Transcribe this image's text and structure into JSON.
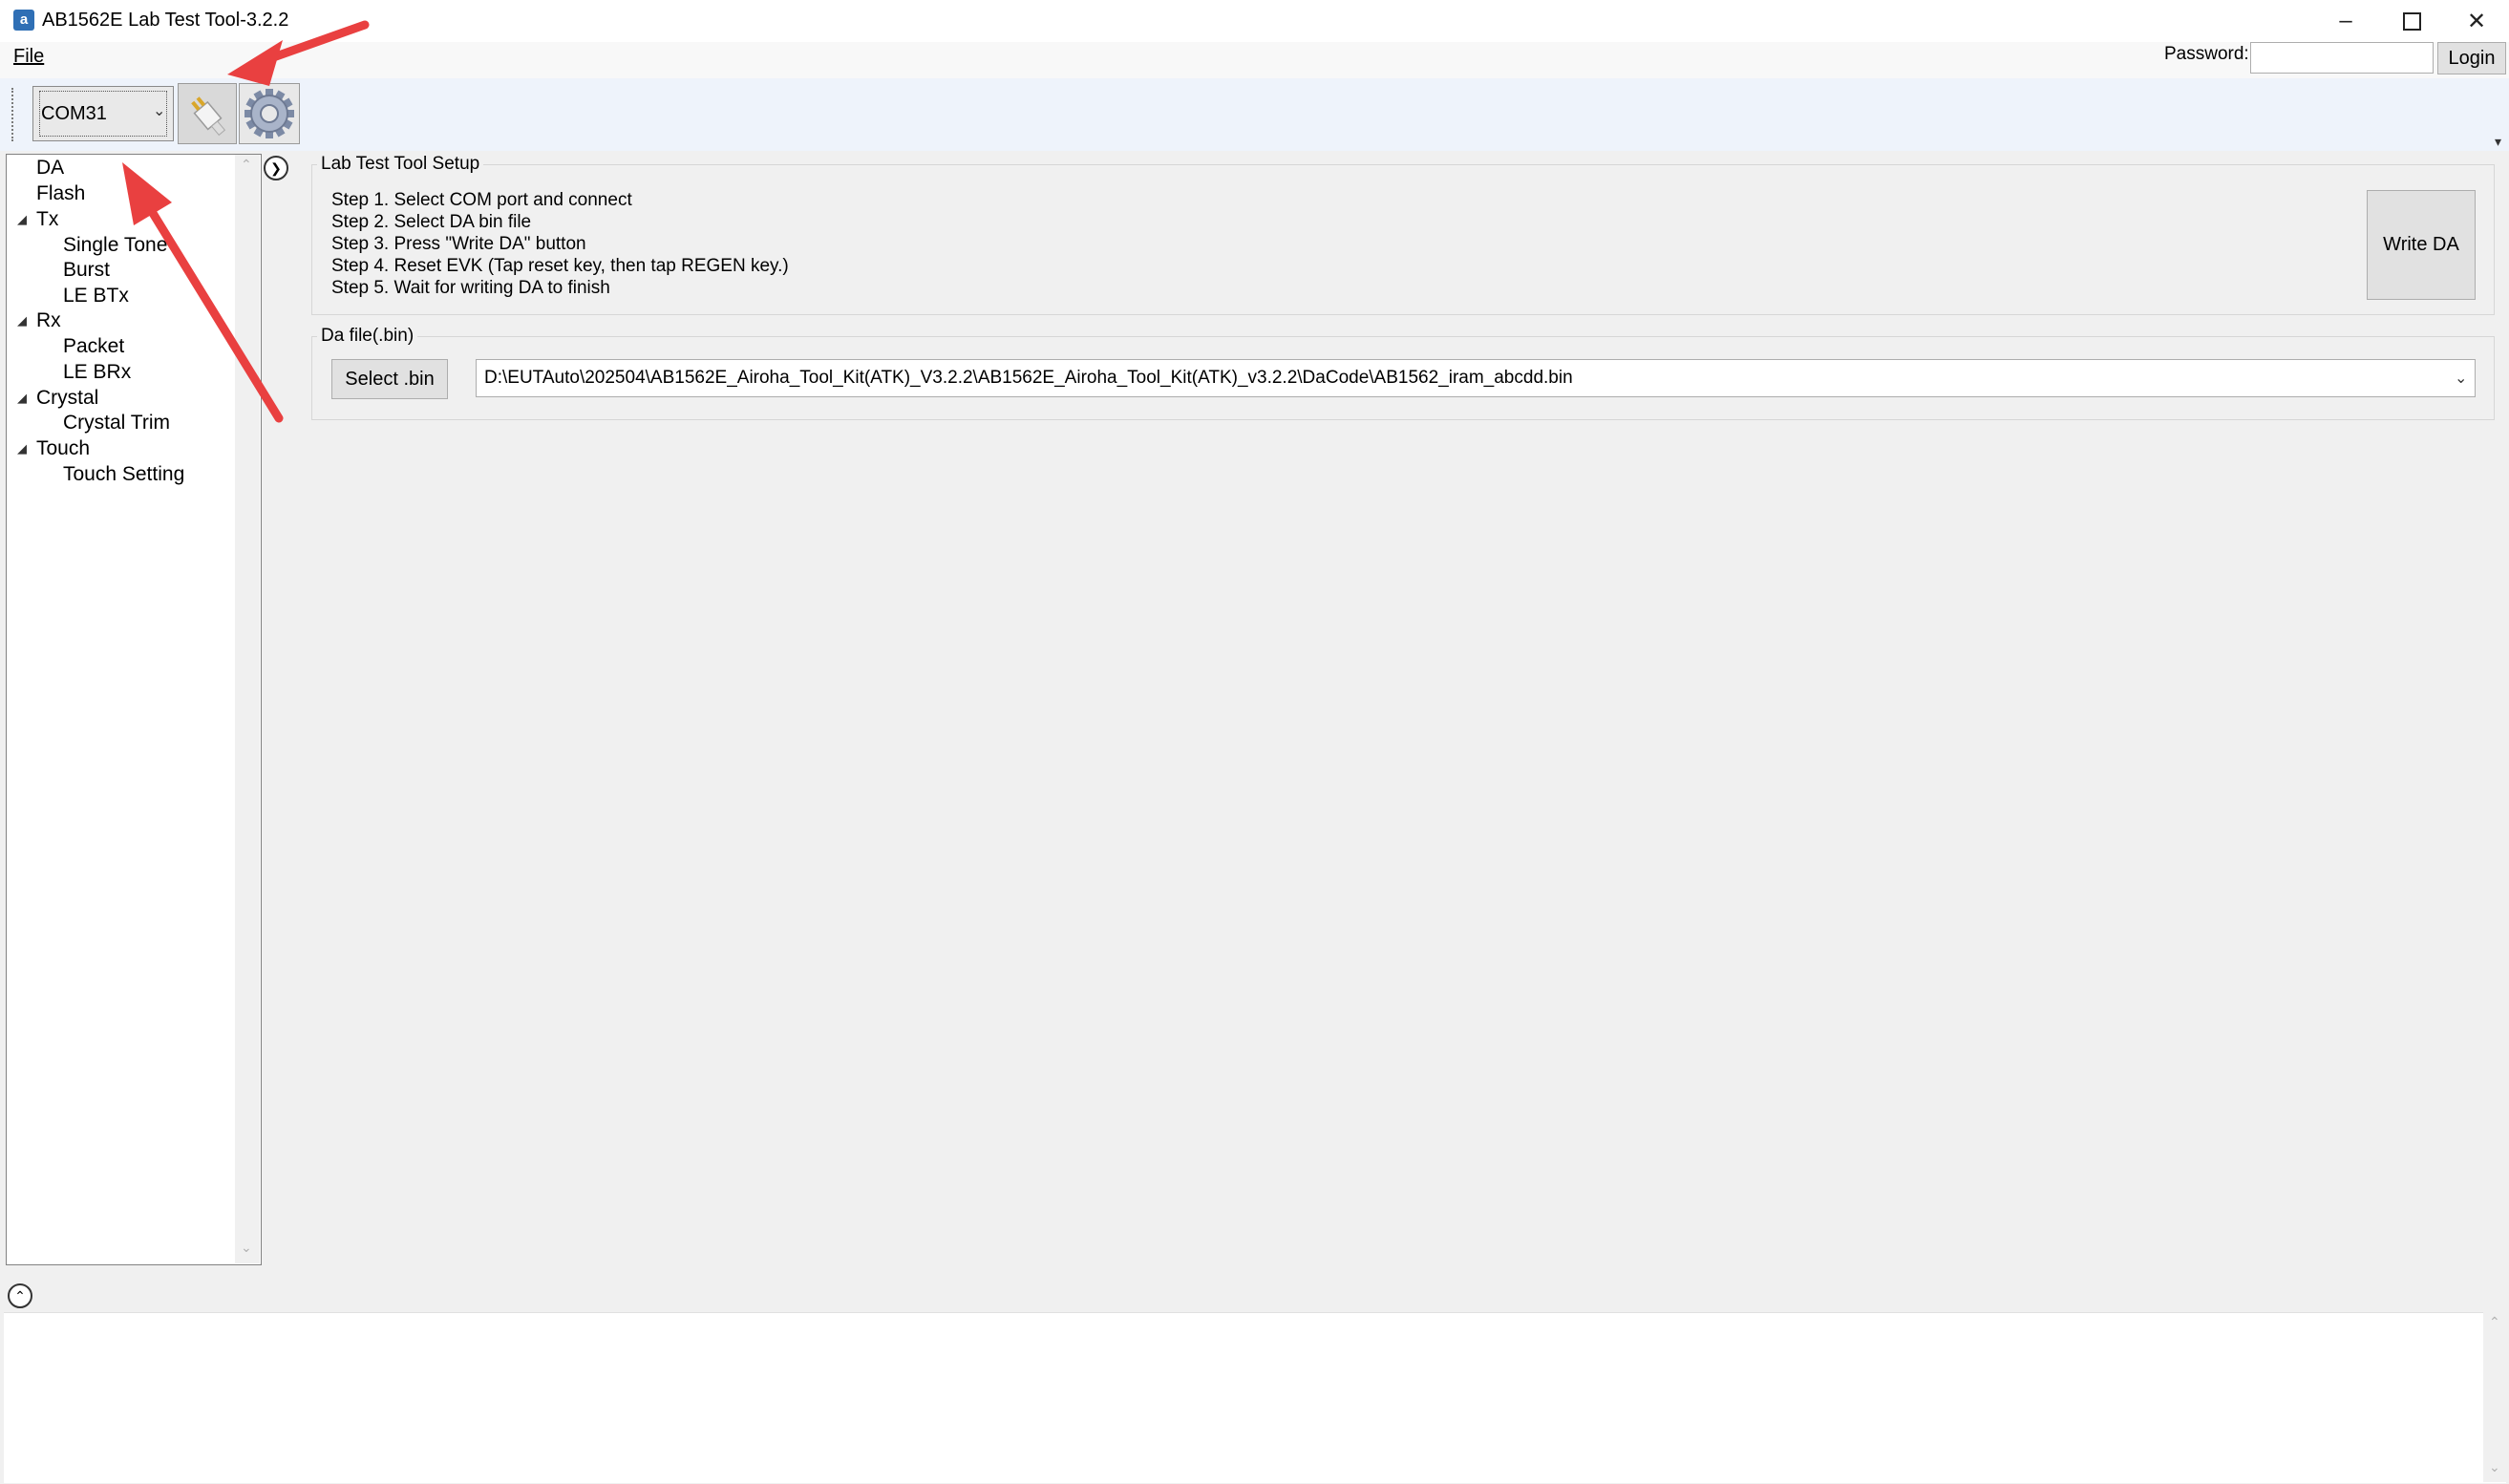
{
  "window": {
    "title": "AB1562E Lab Test Tool-3.2.2",
    "app_icon": "app-icon",
    "controls": [
      "minimize-icon",
      "maximize-icon",
      "close-icon"
    ]
  },
  "menu": {
    "file": "File"
  },
  "auth": {
    "password_label": "Password:",
    "password_value": "",
    "login_label": "Login"
  },
  "toolbar": {
    "com_port": "COM31",
    "connect_icon": "usb-plug-icon",
    "settings_icon": "gear-icon"
  },
  "tree": {
    "nodes": [
      {
        "label": "DA",
        "level": 0,
        "expandable": false
      },
      {
        "label": "Flash",
        "level": 0,
        "expandable": false
      },
      {
        "label": "Tx",
        "level": 0,
        "expandable": true
      },
      {
        "label": "Single Tone",
        "level": 1,
        "expandable": false
      },
      {
        "label": "Burst",
        "level": 1,
        "expandable": false
      },
      {
        "label": "LE BTx",
        "level": 1,
        "expandable": false
      },
      {
        "label": "Rx",
        "level": 0,
        "expandable": true
      },
      {
        "label": "Packet",
        "level": 1,
        "expandable": false
      },
      {
        "label": "LE BRx",
        "level": 1,
        "expandable": false
      },
      {
        "label": "Crystal",
        "level": 0,
        "expandable": true
      },
      {
        "label": "Crystal Trim",
        "level": 1,
        "expandable": false
      },
      {
        "label": "Touch",
        "level": 0,
        "expandable": true
      },
      {
        "label": "Touch Setting",
        "level": 1,
        "expandable": false
      }
    ]
  },
  "setup": {
    "title": "Lab Test Tool Setup",
    "steps": [
      "Step 1. Select COM port and connect",
      "Step 2. Select DA bin file",
      "Step 3. Press \"Write DA\" button",
      "Step 4. Reset EVK (Tap reset key, then tap REGEN key.)",
      "Step 5. Wait for writing DA to finish"
    ],
    "write_da_label": "Write DA"
  },
  "dafile": {
    "title": "Da file(.bin)",
    "select_label": "Select .bin",
    "path": "D:\\EUTAuto\\202504\\AB1562E_Airoha_Tool_Kit(ATK)_V3.2.2\\AB1562E_Airoha_Tool_Kit(ATK)_v3.2.2\\DaCode\\AB1562_iram_abcdd.bin"
  },
  "colors": {
    "annotation_arrow": "#e94040",
    "toolbar_bg": "#eef3fb"
  }
}
